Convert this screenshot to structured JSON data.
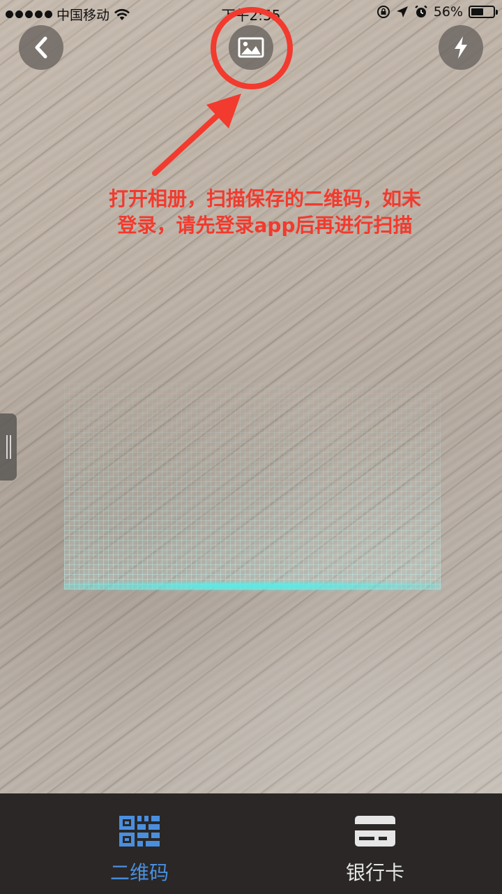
{
  "status_bar": {
    "carrier": "中国移动",
    "time": "下午2:55",
    "battery_percent": "56%",
    "battery_level": 0.56
  },
  "top_bar": {
    "back_icon": "chevron-left-icon",
    "album_icon": "image-icon",
    "flash_icon": "lightning-icon"
  },
  "annotation": {
    "line1": "打开相册，扫描保存的二维码，如未",
    "line2": "登录，请先登录app后再进行扫描",
    "color": "#f23a2e"
  },
  "scan": {
    "line_color": "#5ae6e0"
  },
  "tabs": [
    {
      "label": "二维码",
      "icon": "qr-code-icon",
      "active": true,
      "color": "#4a8fdf"
    },
    {
      "label": "银行卡",
      "icon": "bank-card-icon",
      "active": false,
      "color": "#e6e6e6"
    }
  ]
}
